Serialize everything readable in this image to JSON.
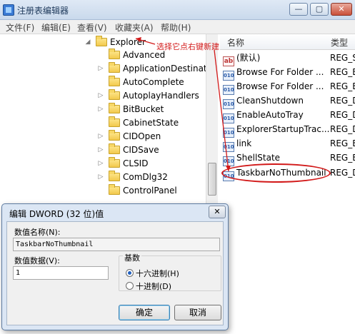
{
  "window": {
    "title": "注册表编辑器",
    "controls": [
      "—",
      "▢",
      "✕"
    ]
  },
  "menu": [
    "文件(F)",
    "编辑(E)",
    "查看(V)",
    "收藏夹(A)",
    "帮助(H)"
  ],
  "tree": {
    "root": "Explorer",
    "items": [
      "Advanced",
      "ApplicationDestinatio",
      "AutoComplete",
      "AutoplayHandlers",
      "BitBucket",
      "CabinetState",
      "CIDOpen",
      "CIDSave",
      "CLSID",
      "ComDlg32",
      "ControlPanel"
    ]
  },
  "annotation": "选择它点右键新建",
  "list": {
    "columns": {
      "name": "名称",
      "type": "类型"
    },
    "rows": [
      {
        "icon": "ab",
        "name": "(默认)",
        "type": "REG_S"
      },
      {
        "icon": "bin",
        "name": "Browse For Folder ...",
        "type": "REG_B"
      },
      {
        "icon": "bin",
        "name": "Browse For Folder ...",
        "type": "REG_B"
      },
      {
        "icon": "bin",
        "name": "CleanShutdown",
        "type": "REG_D"
      },
      {
        "icon": "bin",
        "name": "EnableAutoTray",
        "type": "REG_D"
      },
      {
        "icon": "bin",
        "name": "ExplorerStartupTrac...",
        "type": "REG_D"
      },
      {
        "icon": "bin",
        "name": "link",
        "type": "REG_B"
      },
      {
        "icon": "bin",
        "name": "ShellState",
        "type": "REG_B"
      },
      {
        "icon": "bin",
        "name": "TaskbarNoThumbnail",
        "type": "REG_D"
      }
    ]
  },
  "dialog": {
    "title": "编辑 DWORD (32 位)值",
    "close": "✕",
    "name_label": "数值名称(N):",
    "name_value": "TaskbarNoThumbnail",
    "data_label": "数值数据(V):",
    "data_value": "1",
    "base_label": "基数",
    "hex_label": "十六进制(H)",
    "dec_label": "十进制(D)",
    "ok": "确定",
    "cancel": "取消"
  },
  "colors": {
    "annotation": "#d21919",
    "titlebar": "#c9d9ec"
  }
}
